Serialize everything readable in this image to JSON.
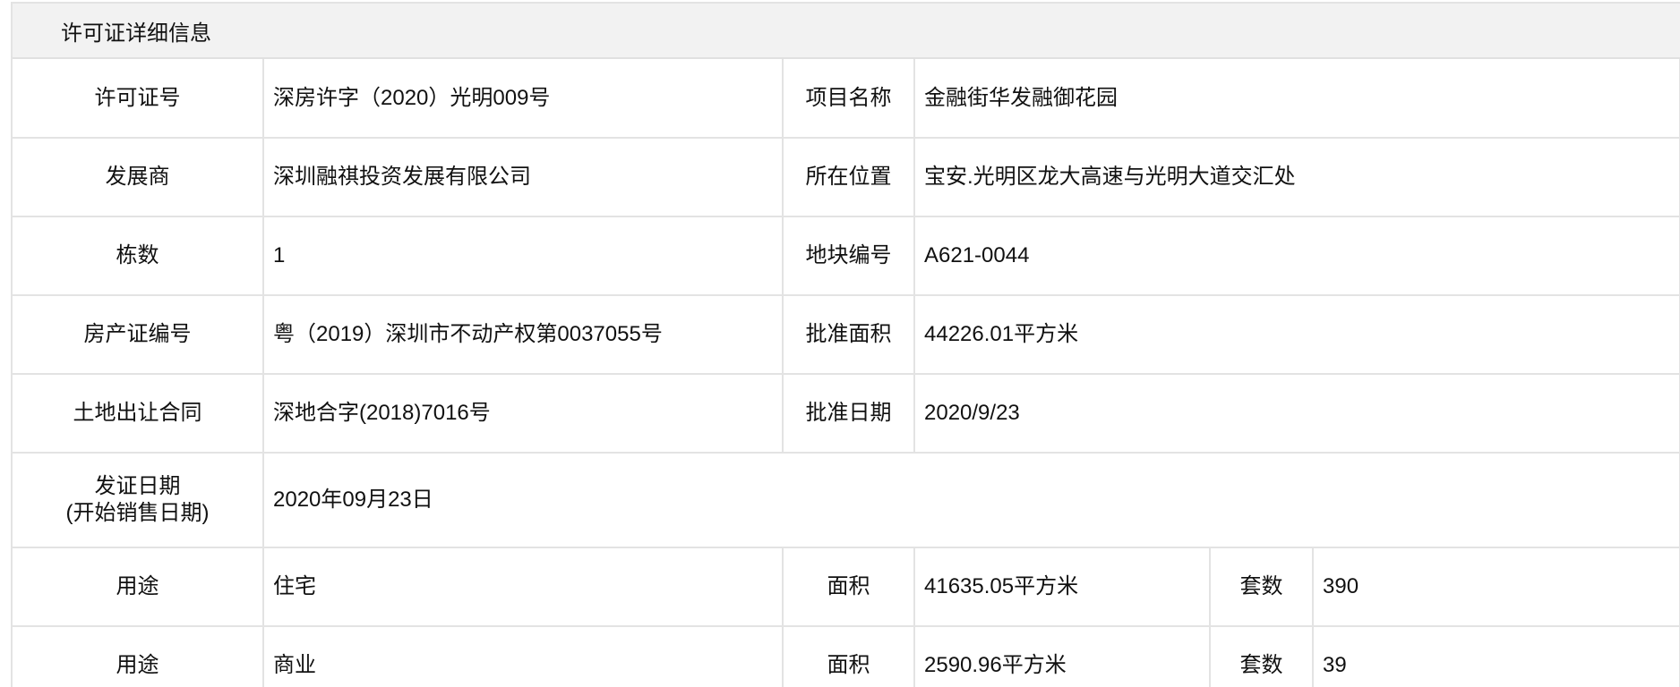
{
  "header": {
    "title": "许可证详细信息"
  },
  "rows": {
    "license_no": {
      "label": "许可证号",
      "value": "深房许字（2020）光明009号"
    },
    "project_name": {
      "label": "项目名称",
      "value": "金融街华发融御花园"
    },
    "developer": {
      "label": "发展商",
      "value": "深圳融祺投资发展有限公司"
    },
    "location": {
      "label": "所在位置",
      "value": "宝安.光明区龙大高速与光明大道交汇处"
    },
    "buildings": {
      "label": "栋数",
      "value": "1"
    },
    "plot_no": {
      "label": "地块编号",
      "value": "A621-0044"
    },
    "property_cert": {
      "label": "房产证编号",
      "value": "粤（2019）深圳市不动产权第0037055号"
    },
    "approved_area": {
      "label": "批准面积",
      "value": "44226.01平方米"
    },
    "land_contract": {
      "label": "土地出让合同",
      "value": "深地合字(2018)7016号"
    },
    "approved_date": {
      "label": "批准日期",
      "value": "2020/9/23"
    },
    "issue_date": {
      "label_line1": "发证日期",
      "label_line2": "(开始销售日期)",
      "value": "2020年09月23日"
    }
  },
  "usage_rows": [
    {
      "usage_label": "用途",
      "usage": "住宅",
      "area_label": "面积",
      "area": "41635.05平方米",
      "units_label": "套数",
      "units": "390"
    },
    {
      "usage_label": "用途",
      "usage": "商业",
      "area_label": "面积",
      "area": "2590.96平方米",
      "units_label": "套数",
      "units": "39"
    }
  ]
}
